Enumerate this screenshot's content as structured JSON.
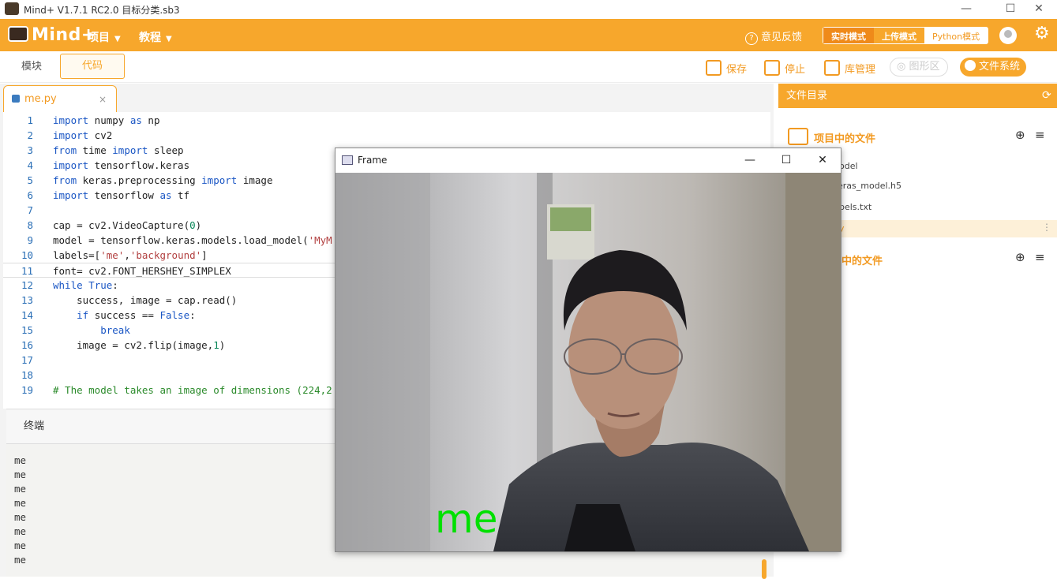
{
  "titlebar": {
    "title": "Mind+ V1.7.1 RC2.0   目标分类.sb3",
    "min": "—",
    "max": "☐",
    "close": "✕"
  },
  "menubar": {
    "brand": "Mind+",
    "menus": [
      "项目",
      "教程"
    ],
    "feedback": "意见反馈",
    "modes": [
      "实时模式",
      "上传模式",
      "Python模式"
    ]
  },
  "toolbar": {
    "tabs": [
      "模块",
      "代码"
    ],
    "save": "保存",
    "stop": "停止",
    "lib": "库管理",
    "graph": "图形区",
    "fs": "文件系统"
  },
  "editor": {
    "file_tab": "me.py",
    "close": "×",
    "lines": [
      {
        "n": "1",
        "html": "<span class='kw'>import</span> numpy <span class='kw'>as</span> np"
      },
      {
        "n": "2",
        "html": "<span class='kw'>import</span> cv2"
      },
      {
        "n": "3",
        "html": "<span class='kw'>from</span> time <span class='kw'>import</span> sleep"
      },
      {
        "n": "4",
        "html": "<span class='kw'>import</span> tensorflow.keras"
      },
      {
        "n": "5",
        "html": "<span class='kw'>from</span> keras.preprocessing <span class='kw'>import</span> image"
      },
      {
        "n": "6",
        "html": "<span class='kw'>import</span> tensorflow <span class='kw'>as</span> tf"
      },
      {
        "n": "7",
        "html": ""
      },
      {
        "n": "8",
        "html": "cap = cv2.VideoCapture(<span class='num'>0</span>)"
      },
      {
        "n": "9",
        "html": "model = tensorflow.keras.models.load_model(<span class='str'>'MyM</span>"
      },
      {
        "n": "10",
        "html": "labels=[<span class='str'>'me'</span>,<span class='str'>'background'</span>]"
      },
      {
        "n": "11",
        "html": "font= cv2.FONT_HERSHEY_SIMPLEX"
      },
      {
        "n": "12",
        "html": "<span class='kw'>while</span> <span class='kw'>True</span>:"
      },
      {
        "n": "13",
        "html": "    success, image = cap.read()"
      },
      {
        "n": "14",
        "html": "    <span class='kw'>if</span> success == <span class='kw'>False</span>:"
      },
      {
        "n": "15",
        "html": "        <span class='kw'>break</span>"
      },
      {
        "n": "16",
        "html": "    image = cv2.flip(image,<span class='num'>1</span>)"
      },
      {
        "n": "17",
        "html": ""
      },
      {
        "n": "18",
        "html": ""
      },
      {
        "n": "19",
        "html": "<span class='cm'># The model takes an image of dimensions (224,2</span>"
      }
    ]
  },
  "terminal": {
    "title": "终端",
    "output": [
      "me",
      "me",
      "me",
      "me",
      "me",
      "me",
      "me",
      "me"
    ]
  },
  "right_panel": {
    "title": "文件目录",
    "project_files": "项目中的文件",
    "files": [
      "odel",
      "eras_model.h5",
      "bels.txt",
      "y"
    ],
    "computer_files": "中的文件"
  },
  "frame_window": {
    "title": "Frame",
    "overlay_label": "me",
    "overlay_color": "#00e000"
  },
  "colors": {
    "accent": "#f7a72c"
  }
}
